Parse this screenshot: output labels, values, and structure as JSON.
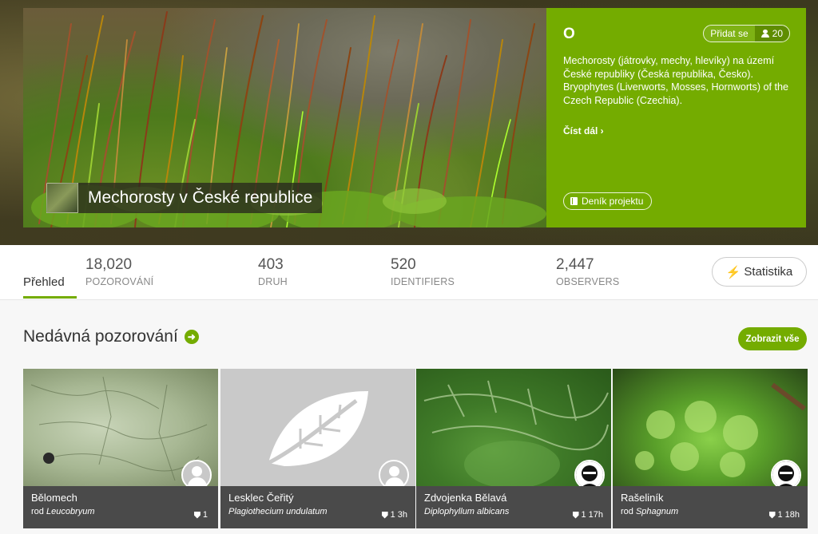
{
  "project": {
    "title": "Mechorosty v České republice",
    "icon": "O",
    "join_label": "Přidat se",
    "member_count": "20",
    "description": "Mechorosty (játrovky, mechy, hlevíky) na území České republiky (Česká republika, Česko). Bryophytes (Liverworts, Mosses, Hornworts) of the Czech Republic (Czechia).",
    "read_more": "Číst dál ›",
    "journal_label": "Deník projektu"
  },
  "stats": {
    "overview_tab": "Přehled",
    "items": [
      {
        "value": "18,020",
        "label": "POZOROVÁNÍ"
      },
      {
        "value": "403",
        "label": "DRUH"
      },
      {
        "value": "520",
        "label": "IDENTIFIERS"
      },
      {
        "value": "2,447",
        "label": "OBSERVERS"
      }
    ],
    "stats_button": "Statistika"
  },
  "recent": {
    "title": "Nedávná pozorování",
    "view_all": "Zobrazit vše",
    "cards": [
      {
        "name": "Bělomech",
        "rank": "rod ",
        "latin": "Leucobryum",
        "ids": "1",
        "age": "",
        "avatar": "default"
      },
      {
        "name": "Lesklec Čeřitý",
        "rank": "",
        "latin": "Plagiothecium undulatum",
        "ids": "1",
        "age": "3h",
        "avatar": "default"
      },
      {
        "name": "Zdvojenka Bělavá",
        "rank": "",
        "latin": "Diplophyllum albicans",
        "ids": "1",
        "age": "17h",
        "avatar": "photo"
      },
      {
        "name": "Rašeliník",
        "rank": "rod ",
        "latin": "Sphagnum",
        "ids": "1",
        "age": "18h",
        "avatar": "photo"
      }
    ]
  },
  "colors": {
    "accent": "#74ac00",
    "card_footer": "#4a4a4a"
  }
}
